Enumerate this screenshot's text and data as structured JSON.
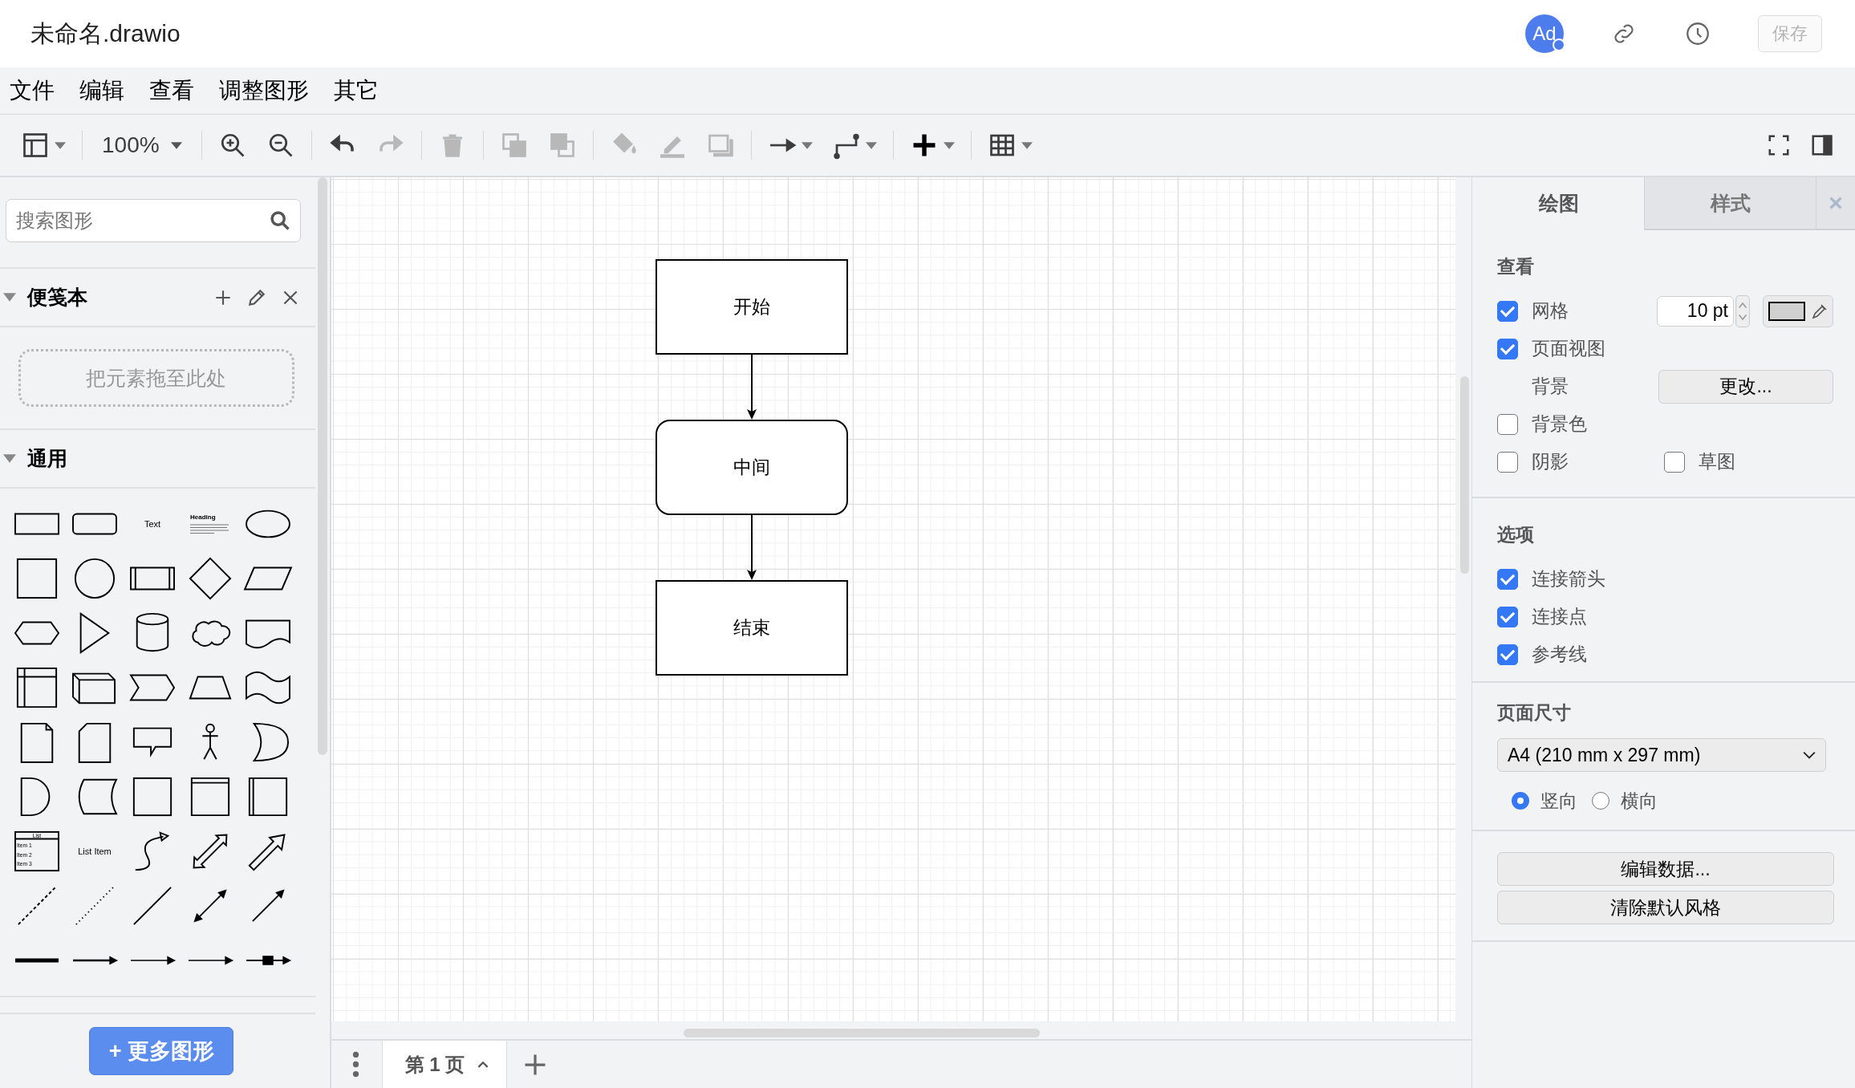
{
  "window": {
    "title": "未命名.drawio"
  },
  "header": {
    "avatar": "Ad",
    "save_button": {
      "label": "保存",
      "disabled": true
    }
  },
  "menu": [
    "文件",
    "编辑",
    "查看",
    "调整图形",
    "其它"
  ],
  "toolbar": {
    "items": [
      {
        "kind": "layout",
        "disabled": false
      },
      {
        "kind": "divider"
      },
      {
        "kind": "zoom-level",
        "label": "100%",
        "disabled": false
      },
      {
        "kind": "divider"
      },
      {
        "kind": "zoom-in",
        "disabled": false
      },
      {
        "kind": "zoom-out",
        "disabled": false
      },
      {
        "kind": "divider"
      },
      {
        "kind": "undo",
        "disabled": false
      },
      {
        "kind": "redo",
        "disabled": true
      },
      {
        "kind": "divider"
      },
      {
        "kind": "delete",
        "disabled": true
      },
      {
        "kind": "divider"
      },
      {
        "kind": "to-front",
        "disabled": true
      },
      {
        "kind": "to-back",
        "disabled": true
      },
      {
        "kind": "divider"
      },
      {
        "kind": "fill",
        "disabled": true
      },
      {
        "kind": "line-color",
        "disabled": true
      },
      {
        "kind": "shadow",
        "disabled": true
      },
      {
        "kind": "divider"
      },
      {
        "kind": "connection",
        "disabled": false
      },
      {
        "kind": "waypoints",
        "disabled": false
      },
      {
        "kind": "divider"
      },
      {
        "kind": "insert",
        "disabled": false
      },
      {
        "kind": "divider"
      },
      {
        "kind": "table",
        "disabled": false
      }
    ],
    "right_items": [
      {
        "kind": "fullscreen",
        "disabled": false
      },
      {
        "kind": "format-panel",
        "disabled": false
      }
    ]
  },
  "sidebar": {
    "search": {
      "placeholder": "搜索图形"
    },
    "scratchpad": {
      "title": "便笺本",
      "expanded": true,
      "drop_hint": "把元素拖至此处"
    },
    "general": {
      "title": "通用",
      "expanded": true,
      "shapes": [
        {
          "kind": "rect"
        },
        {
          "kind": "rounded-rect"
        },
        {
          "kind": "text",
          "label": "Text"
        },
        {
          "kind": "textbox",
          "label": "Heading"
        },
        {
          "kind": "ellipse"
        },
        {
          "kind": "square"
        },
        {
          "kind": "circle"
        },
        {
          "kind": "process"
        },
        {
          "kind": "diamond"
        },
        {
          "kind": "parallelogram"
        },
        {
          "kind": "hexagon"
        },
        {
          "kind": "triangle"
        },
        {
          "kind": "cylinder"
        },
        {
          "kind": "cloud"
        },
        {
          "kind": "document"
        },
        {
          "kind": "internal-storage"
        },
        {
          "kind": "cube"
        },
        {
          "kind": "step"
        },
        {
          "kind": "trapezoid"
        },
        {
          "kind": "tape"
        },
        {
          "kind": "note"
        },
        {
          "kind": "card"
        },
        {
          "kind": "callout"
        },
        {
          "kind": "actor"
        },
        {
          "kind": "or"
        },
        {
          "kind": "and"
        },
        {
          "kind": "data-storage"
        },
        {
          "kind": "container"
        },
        {
          "kind": "vertical-container"
        },
        {
          "kind": "horizontal-container"
        },
        {
          "kind": "list",
          "label": "List",
          "items": [
            "Item 1",
            "Item 2",
            "Item 3"
          ]
        },
        {
          "kind": "text",
          "label": "List Item"
        },
        {
          "kind": "curve"
        },
        {
          "kind": "bidirectional-arrow"
        },
        {
          "kind": "arrow"
        },
        {
          "kind": "dashed-line"
        },
        {
          "kind": "dotted-line"
        },
        {
          "kind": "line"
        },
        {
          "kind": "double-arrow-line"
        },
        {
          "kind": "arrow-line"
        },
        {
          "kind": "thick-line"
        },
        {
          "kind": "labeled-edge"
        },
        {
          "kind": "source-edge"
        },
        {
          "kind": "source-target-edge"
        },
        {
          "kind": "message-edge"
        }
      ]
    },
    "more_button": "+ 更多图形"
  },
  "diagram": {
    "nodes": [
      {
        "label": "开始",
        "kind": "rect",
        "arrow_out": true
      },
      {
        "label": "中间",
        "kind": "rounded",
        "arrow_out": true
      },
      {
        "label": "结束",
        "kind": "rect",
        "arrow_out": false
      }
    ]
  },
  "pages": {
    "tabs": [
      {
        "label": "第 1 页",
        "selected": true
      }
    ]
  },
  "format_panel": {
    "tabs": [
      {
        "label": "绘图",
        "selected": true
      },
      {
        "label": "样式",
        "selected": false
      }
    ],
    "view": {
      "title": "查看",
      "grid": {
        "label": "网格",
        "checked": true,
        "size": "10 pt"
      },
      "page_view": {
        "label": "页面视图",
        "checked": true
      },
      "background": {
        "label": "背景",
        "button": "更改..."
      },
      "background_color": {
        "label": "背景色",
        "checked": false
      },
      "shadow": {
        "label": "阴影",
        "checked": false
      },
      "sketch": {
        "label": "草图",
        "checked": false
      }
    },
    "options": {
      "title": "选项",
      "items": [
        {
          "label": "连接箭头",
          "checked": true
        },
        {
          "label": "连接点",
          "checked": true
        },
        {
          "label": "参考线",
          "checked": true
        }
      ]
    },
    "page_size": {
      "title": "页面尺寸",
      "value": "A4 (210 mm x 297 mm)",
      "orientations": [
        {
          "label": "竖向",
          "selected": true
        },
        {
          "label": "横向",
          "selected": false
        }
      ]
    },
    "buttons": [
      "编辑数据...",
      "清除默认风格"
    ]
  }
}
